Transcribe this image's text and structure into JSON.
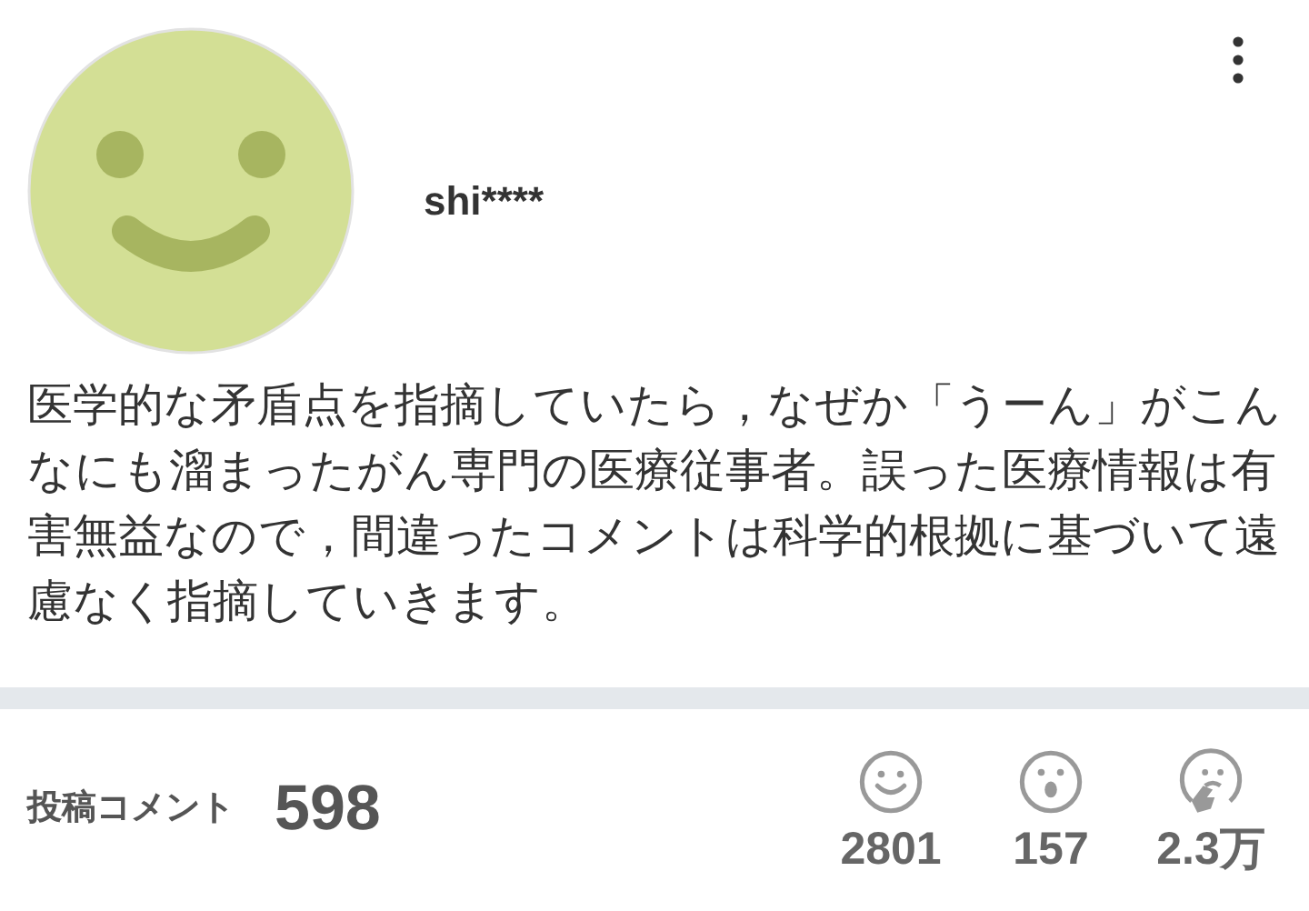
{
  "profile": {
    "username": "shi****",
    "bio": "医学的な矛盾点を指摘していたら，なぜか「うーん」がこんなにも溜まったがん専門の医療従事者。誤った医療情報は有害無益なので，間違ったコメントは科学的根拠に基づいて遠慮なく指摘していきます。"
  },
  "stats": {
    "label": "投稿コメント",
    "count": "598"
  },
  "reactions": [
    {
      "kind": "smile",
      "count": "2801"
    },
    {
      "kind": "surprised",
      "count": "157"
    },
    {
      "kind": "thinking",
      "count": "2.3万"
    }
  ]
}
